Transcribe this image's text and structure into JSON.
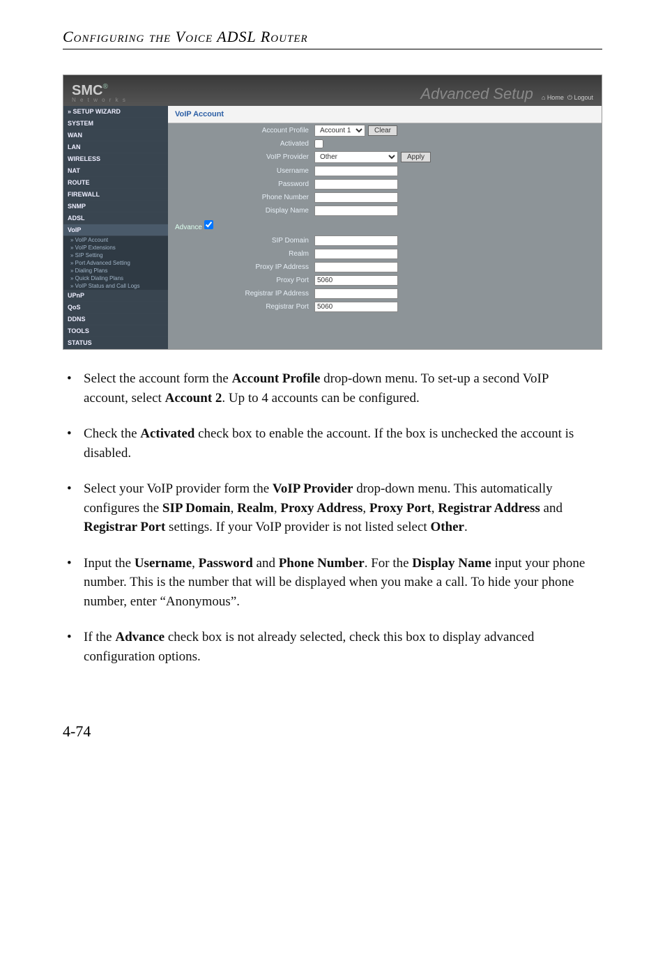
{
  "running_head": "Configuring the Voice ADSL Router",
  "screenshot": {
    "logo": "SMC",
    "logo_sub": "N e t w o r k s",
    "brand_right": "Advanced Setup",
    "home_link": "Home",
    "logout_link": "Logout",
    "nav": {
      "setup_wizard": "» SETUP WIZARD",
      "system": "SYSTEM",
      "wan": "WAN",
      "lan": "LAN",
      "wireless": "WIRELESS",
      "nat": "NAT",
      "route": "ROUTE",
      "firewall": "FIREWALL",
      "snmp": "SNMP",
      "adsl": "ADSL",
      "voip": "VoIP",
      "voip_account": "» VoIP Account",
      "voip_ext": "» VoIP Extensions",
      "sip_setting": "» SIP Setting",
      "port_adv": "» Port Advanced Setting",
      "dialing_plans": "» Dialing Plans",
      "quick_dialing": "» Quick Dialing Plans",
      "voip_status": "» VoIP Status and Call Logs",
      "upnp": "UPnP",
      "qos": "QoS",
      "ddns": "DDNS",
      "tools": "TOOLS",
      "status": "STATUS"
    },
    "section_title": "VoIP Account",
    "labels": {
      "account_profile": "Account Profile",
      "activated": "Activated",
      "voip_provider": "VoIP Provider",
      "username": "Username",
      "password": "Password",
      "phone_number": "Phone Number",
      "display_name": "Display Name",
      "advance": "Advance",
      "sip_domain": "SIP Domain",
      "realm": "Realm",
      "proxy_ip": "Proxy IP Address",
      "proxy_port": "Proxy Port",
      "registrar_ip": "Registrar IP Address",
      "registrar_port": "Registrar Port"
    },
    "values": {
      "account_profile_selected": "Account 1",
      "voip_provider_selected": "Other",
      "proxy_port": "5060",
      "registrar_port": "5060"
    },
    "buttons": {
      "clear": "Clear",
      "apply": "Apply"
    }
  },
  "bullets": {
    "b1_p1": "Select the account form the ",
    "b1_s1": "Account Profile",
    "b1_p2": " drop-down menu. To set-up a second VoIP account, select ",
    "b1_s2": "Account 2",
    "b1_p3": ". Up to 4 accounts can be configured.",
    "b2_p1": "Check the ",
    "b2_s1": "Activated",
    "b2_p2": " check box to enable the account. If the box is unchecked the account is disabled.",
    "b3_p1": "Select your VoIP provider form the ",
    "b3_s1": "VoIP Provider",
    "b3_p2": " drop-down menu. This automatically configures the ",
    "b3_s2": "SIP Domain",
    "b3_c1": ", ",
    "b3_s3": "Realm",
    "b3_c2": ", ",
    "b3_s4": "Proxy Address",
    "b3_c3": ", ",
    "b3_s5": "Proxy Port",
    "b3_c4": ", ",
    "b3_s6": "Registrar Address",
    "b3_p3": " and ",
    "b3_s7": "Registrar Port",
    "b3_p4": " settings. If your VoIP provider is not listed select ",
    "b3_s8": "Other",
    "b3_p5": ".",
    "b4_p1": "Input the ",
    "b4_s1": "Username",
    "b4_c1": ", ",
    "b4_s2": "Password",
    "b4_p2": " and ",
    "b4_s3": "Phone Number",
    "b4_p3": ". For the ",
    "b4_s4": "Display Name",
    "b4_p4": " input your phone number. This is the number that will be displayed when you make a call. To hide your phone number, enter “Anonymous”.",
    "b5_p1": "If the ",
    "b5_s1": "Advance",
    "b5_p2": " check box is not already selected, check this box to display advanced configuration options."
  },
  "page_number": "4-74"
}
